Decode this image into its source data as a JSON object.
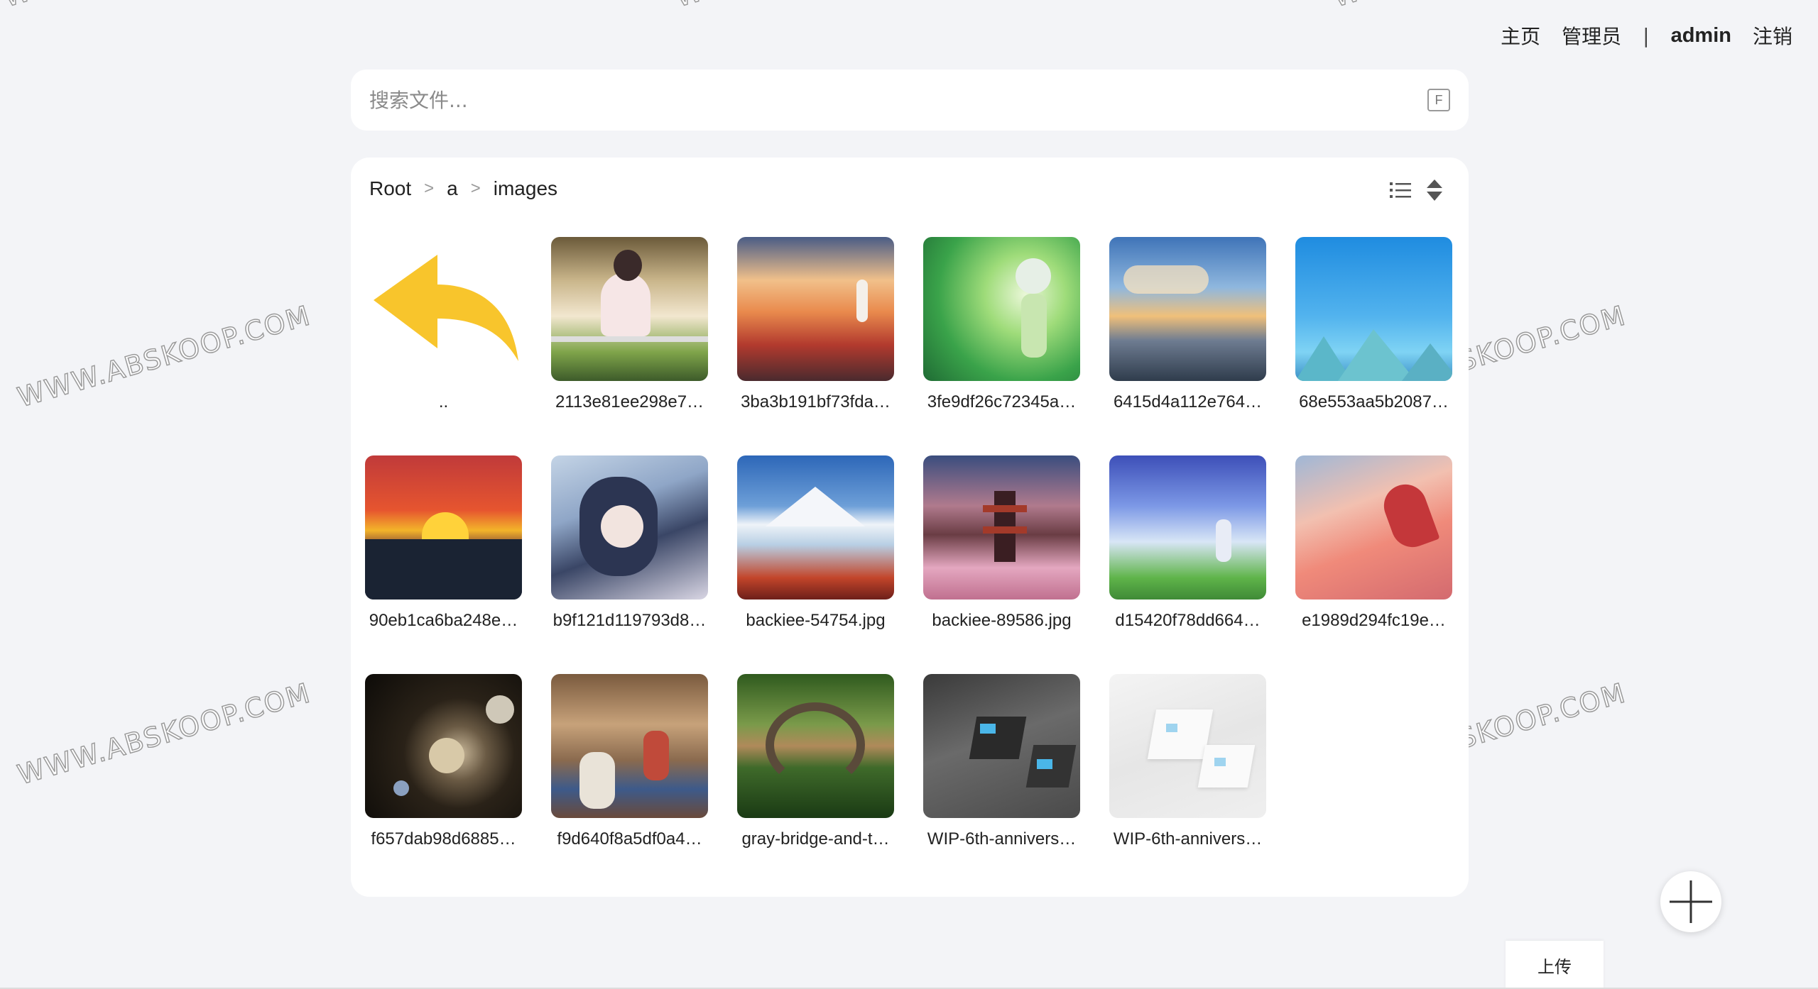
{
  "nav": {
    "home": "主页",
    "admin_panel": "管理员",
    "separator": "|",
    "username": "admin",
    "logout": "注销"
  },
  "search": {
    "placeholder": "搜索文件...",
    "shortcut": "F"
  },
  "breadcrumb": {
    "items": [
      "Root",
      "a",
      "images"
    ],
    "separator": ">"
  },
  "files": [
    {
      "name": "..",
      "type": "parent"
    },
    {
      "name": "2113e81ee298e7…"
    },
    {
      "name": "3ba3b191bf73fda…"
    },
    {
      "name": "3fe9df26c72345a…"
    },
    {
      "name": "6415d4a112e764…"
    },
    {
      "name": "68e553aa5b2087…"
    },
    {
      "name": "90eb1ca6ba248e…"
    },
    {
      "name": "b9f121d119793d8…"
    },
    {
      "name": "backiee-54754.jpg"
    },
    {
      "name": "backiee-89586.jpg"
    },
    {
      "name": "d15420f78dd664…"
    },
    {
      "name": "e1989d294fc19e…"
    },
    {
      "name": "f657dab98d6885…"
    },
    {
      "name": "f9d640f8a5df0a4…"
    },
    {
      "name": "gray-bridge-and-t…"
    },
    {
      "name": "WIP-6th-annivers…"
    },
    {
      "name": "WIP-6th-annivers…"
    }
  ],
  "actions": {
    "upload": "上传"
  },
  "watermark": "WWW.ABSKOOP.COM",
  "colors": {
    "background": "#f3f4f7",
    "panel": "#ffffff",
    "back_arrow": "#f8c52c"
  },
  "icons": {
    "view_toggle": "list-icon",
    "sort": "sort-icon",
    "back": "back-arrow-icon",
    "add": "plus-icon"
  }
}
